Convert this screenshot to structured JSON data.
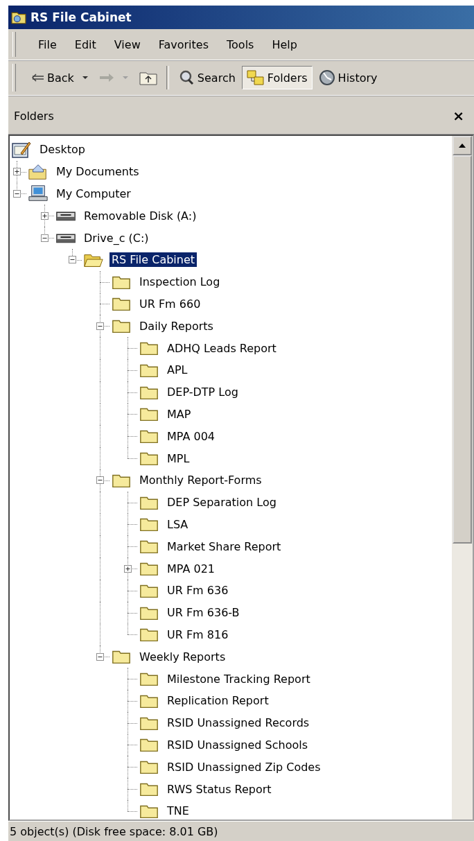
{
  "window": {
    "title": "RS File Cabinet"
  },
  "menu": [
    "File",
    "Edit",
    "View",
    "Favorites",
    "Tools",
    "Help"
  ],
  "toolbar": [
    {
      "kind": "back",
      "label": "Back",
      "disabled": false
    },
    {
      "kind": "forward",
      "disabled": true
    },
    {
      "kind": "up"
    },
    {
      "kind": "search",
      "label": "Search",
      "pressed": false
    },
    {
      "kind": "folders",
      "label": "Folders",
      "pressed": true
    },
    {
      "kind": "history",
      "label": "History",
      "pressed": false
    }
  ],
  "pane": {
    "title": "Folders",
    "close": "×"
  },
  "tree": [
    {
      "label": "Desktop",
      "kind": "desktop",
      "selected": false,
      "children": [
        {
          "label": "My Documents",
          "kind": "documents",
          "selected": false,
          "expanded": false
        },
        {
          "label": "My Computer",
          "kind": "computer",
          "selected": false,
          "expanded": true,
          "children": [
            {
              "label": "Removable Disk (A:)",
              "kind": "drive",
              "selected": false,
              "expanded": false
            },
            {
              "label": "Drive_c (C:)",
              "kind": "drive",
              "selected": false,
              "expanded": true,
              "children": [
                {
                  "label": "RS File Cabinet",
                  "kind": "open-folder",
                  "selected": true,
                  "expanded": true,
                  "children": [
                    {
                      "label": "Inspection Log",
                      "kind": "folder",
                      "selected": false
                    },
                    {
                      "label": "UR Fm 660",
                      "kind": "folder",
                      "selected": false
                    },
                    {
                      "label": "Daily Reports",
                      "kind": "folder",
                      "selected": false,
                      "expanded": true,
                      "children": [
                        {
                          "label": "ADHQ Leads Report",
                          "kind": "folder",
                          "selected": false
                        },
                        {
                          "label": "APL",
                          "kind": "folder",
                          "selected": false
                        },
                        {
                          "label": "DEP-DTP Log",
                          "kind": "folder",
                          "selected": false
                        },
                        {
                          "label": "MAP",
                          "kind": "folder",
                          "selected": false
                        },
                        {
                          "label": "MPA 004",
                          "kind": "folder",
                          "selected": false
                        },
                        {
                          "label": "MPL",
                          "kind": "folder",
                          "selected": false
                        }
                      ]
                    },
                    {
                      "label": "Monthly Report-Forms",
                      "kind": "folder",
                      "selected": false,
                      "expanded": true,
                      "children": [
                        {
                          "label": "DEP Separation Log",
                          "kind": "folder",
                          "selected": false
                        },
                        {
                          "label": "LSA",
                          "kind": "folder",
                          "selected": false
                        },
                        {
                          "label": "Market Share Report",
                          "kind": "folder",
                          "selected": false
                        },
                        {
                          "label": "MPA 021",
                          "kind": "folder",
                          "selected": false,
                          "expanded": false
                        },
                        {
                          "label": "UR Fm 636",
                          "kind": "folder",
                          "selected": false
                        },
                        {
                          "label": "UR Fm 636-B",
                          "kind": "folder",
                          "selected": false
                        },
                        {
                          "label": "UR Fm 816",
                          "kind": "folder",
                          "selected": false
                        }
                      ]
                    },
                    {
                      "label": "Weekly Reports",
                      "kind": "folder",
                      "selected": false,
                      "expanded": true,
                      "children": [
                        {
                          "label": "Milestone Tracking Report",
                          "kind": "folder",
                          "selected": false
                        },
                        {
                          "label": "Replication Report",
                          "kind": "folder",
                          "selected": false
                        },
                        {
                          "label": "RSID Unassigned Records",
                          "kind": "folder",
                          "selected": false
                        },
                        {
                          "label": "RSID Unassigned Schools",
                          "kind": "folder",
                          "selected": false
                        },
                        {
                          "label": "RSID Unassigned Zip Codes",
                          "kind": "folder",
                          "selected": false
                        },
                        {
                          "label": "RWS Status Report",
                          "kind": "folder",
                          "selected": false
                        },
                        {
                          "label": "TNE",
                          "kind": "folder",
                          "selected": false
                        }
                      ]
                    }
                  ]
                }
              ]
            }
          ]
        }
      ]
    }
  ],
  "status_bar": "5 object(s) (Disk free space: 8.01 GB)"
}
